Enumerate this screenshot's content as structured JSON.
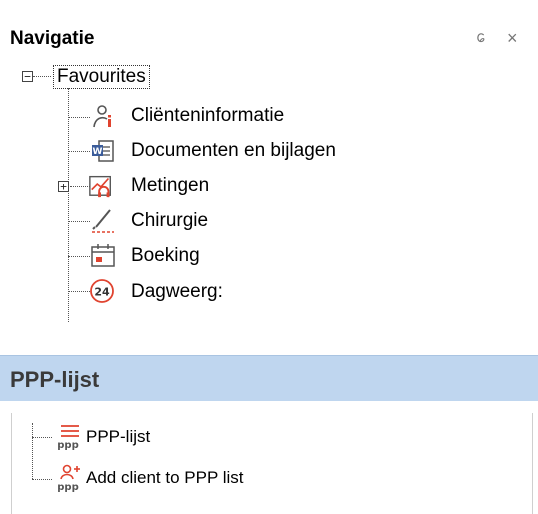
{
  "panel": {
    "title": "Navigatie",
    "pin_icon": "pin-icon",
    "close_icon": "close-icon"
  },
  "tree": {
    "root_label": "Favourites",
    "items": [
      {
        "label": "Cliënteninformatie",
        "icon": "client-info-icon"
      },
      {
        "label": "Documenten en bijlagen",
        "icon": "word-document-icon"
      },
      {
        "label": "Metingen",
        "icon": "measurements-chart-icon"
      },
      {
        "label": "Chirurgie",
        "icon": "scalpel-icon"
      },
      {
        "label": "Boeking",
        "icon": "calendar-icon"
      },
      {
        "label": "Dagweerg:",
        "icon": "24h-clock-icon"
      }
    ]
  },
  "section2": {
    "title": "PPP-lijst",
    "items": [
      {
        "label": "PPP-lijst",
        "icon": "ppp-list-icon"
      },
      {
        "label": "Add client to PPP list",
        "icon": "ppp-add-client-icon"
      }
    ]
  },
  "colors": {
    "section_header_bg": "#bfd6ef",
    "icon_red": "#e0432f",
    "icon_gray": "#555555"
  }
}
